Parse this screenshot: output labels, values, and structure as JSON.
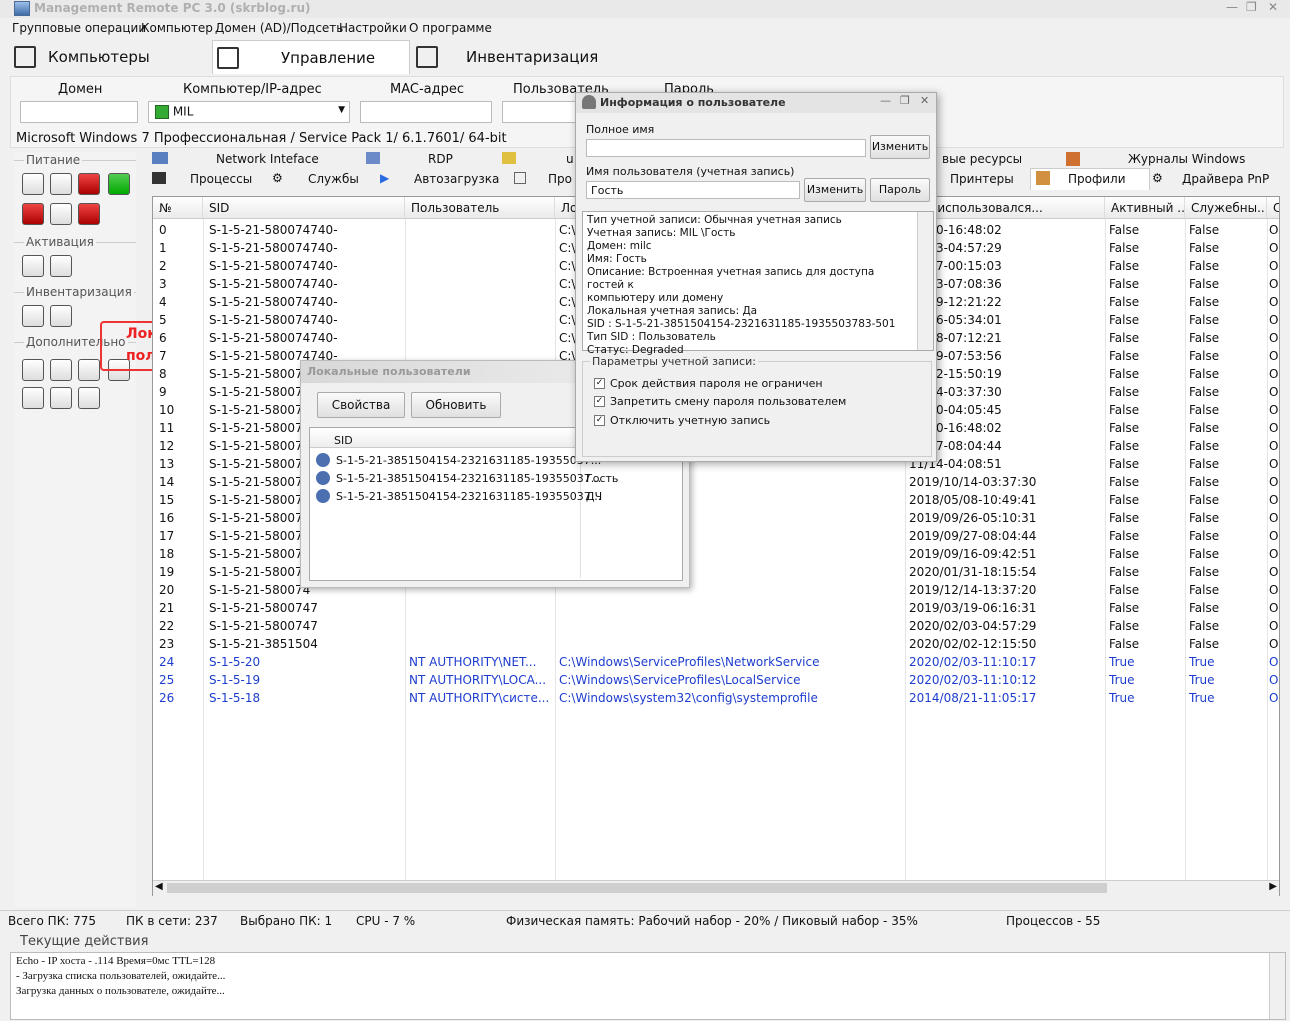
{
  "window": {
    "title": "Management Remote PC 3.0 (skrblog.ru)"
  },
  "menu": [
    "Групповые операции",
    "Компьютер",
    "Домен (AD)/Подсеть",
    "Настройки",
    "О программе"
  ],
  "tabs": {
    "computers": "Компьютеры",
    "control": "Управление",
    "inventory": "Инвентаризация"
  },
  "fields": {
    "domain_label": "Домен",
    "computer_label": "Компьютер/IP-адрес",
    "computer_value": "MIL",
    "mac_label": "MAC-адрес",
    "user_label": "Пользователь",
    "pass_label": "Пароль"
  },
  "os_info": "Microsoft Windows 7 Профессиональная / Service Pack 1/ 6.1.7601/ 64-bit",
  "sidebar": {
    "power": "Питание",
    "activation": "Активация",
    "inventory": "Инвентаризация",
    "extra": "Дополнительно"
  },
  "callout": "Локальные пользователи",
  "subtabs": {
    "network": "Network Inteface",
    "rdp": "RDP",
    "u": "u",
    "shared": "вые ресурсы",
    "journals": "Журналы Windows",
    "processes": "Процессы",
    "services": "Службы",
    "autostart": "Автозагрузка",
    "pro": "Про",
    "printers": "Принтеры",
    "profiles": "Профили",
    "pnp": "Драйвера PnP"
  },
  "grid": {
    "headers": [
      "№",
      "SID",
      "Пользователь",
      "Ло",
      "иль использовался...",
      "Активный ...",
      "Служебны...",
      "Ст"
    ],
    "rows": [
      [
        "0",
        "S-1-5-21-580074740-",
        "",
        "C:\\",
        "01/30-16:48:02",
        "False",
        "False",
        "O"
      ],
      [
        "1",
        "S-1-5-21-580074740-",
        "",
        "C:\\",
        "02/03-04:57:29",
        "False",
        "False",
        "O"
      ],
      [
        "2",
        "S-1-5-21-580074740-",
        "",
        "C:\\",
        "05/17-00:15:03",
        "False",
        "False",
        "O"
      ],
      [
        "3",
        "S-1-5-21-580074740-",
        "",
        "C:\\",
        "01/23-07:08:36",
        "False",
        "False",
        "O"
      ],
      [
        "4",
        "S-1-5-21-580074740-",
        "",
        "C:\\",
        "12/09-12:21:22",
        "False",
        "False",
        "O"
      ],
      [
        "5",
        "S-1-5-21-580074740-",
        "",
        "C:\\",
        "12/06-05:34:01",
        "False",
        "False",
        "O"
      ],
      [
        "6",
        "S-1-5-21-580074740-",
        "",
        "C:\\",
        "11/18-07:12:21",
        "False",
        "False",
        "O"
      ],
      [
        "7",
        "S-1-5-21-580074740-",
        "",
        "C:\\",
        "12/09-07:53:56",
        "False",
        "False",
        "O"
      ],
      [
        "8",
        "S-1-5-21-580074",
        "",
        "",
        "04/22-15:50:19",
        "False",
        "False",
        "O"
      ],
      [
        "9",
        "S-1-5-21-580074",
        "",
        "",
        "10/14-03:37:30",
        "False",
        "False",
        "O"
      ],
      [
        "10",
        "S-1-5-21-580074",
        "",
        "",
        "12/30-04:05:45",
        "False",
        "False",
        "O"
      ],
      [
        "11",
        "S-1-5-21-580074",
        "",
        "",
        "01/30-16:48:02",
        "False",
        "False",
        "O"
      ],
      [
        "12",
        "S-1-5-21-580074",
        "",
        "",
        "09/27-08:04:44",
        "False",
        "False",
        "O"
      ],
      [
        "13",
        "S-1-5-21-580074",
        "",
        "",
        "11/14-04:08:51",
        "False",
        "False",
        "O"
      ],
      [
        "14",
        "S-1-5-21-580074",
        "",
        "",
        "2019/10/14-03:37:30",
        "False",
        "False",
        "O"
      ],
      [
        "15",
        "S-1-5-21-580074",
        "",
        "",
        "2018/05/08-10:49:41",
        "False",
        "False",
        "O"
      ],
      [
        "16",
        "S-1-5-21-580074",
        "",
        "ьга",
        "2019/09/26-05:10:31",
        "False",
        "False",
        "O"
      ],
      [
        "17",
        "S-1-5-21-580074",
        "",
        "лай",
        "2019/09/27-08:04:44",
        "False",
        "False",
        "O"
      ],
      [
        "18",
        "S-1-5-21-580074",
        "",
        "сандр",
        "2019/09/16-09:42:51",
        "False",
        "False",
        "O"
      ],
      [
        "19",
        "S-1-5-21-580074",
        "",
        "",
        "2020/01/31-18:15:54",
        "False",
        "False",
        "O"
      ],
      [
        "20",
        "S-1-5-21-580074",
        "",
        "",
        "2019/12/14-13:37:20",
        "False",
        "False",
        "O"
      ],
      [
        "21",
        "S-1-5-21-5800747",
        "",
        "",
        "2019/03/19-06:16:31",
        "False",
        "False",
        "O"
      ],
      [
        "22",
        "S-1-5-21-5800747",
        "",
        "",
        "2020/02/03-04:57:29",
        "False",
        "False",
        "O"
      ],
      [
        "23",
        "S-1-5-21-3851504",
        "",
        "",
        "2020/02/02-12:15:50",
        "False",
        "False",
        "O"
      ],
      [
        "24",
        "S-1-5-20",
        "NT AUTHORITY\\NET...",
        "C:\\Windows\\ServiceProfiles\\NetworkService",
        "2020/02/03-11:10:17",
        "True",
        "True",
        "O"
      ],
      [
        "25",
        "S-1-5-19",
        "NT AUTHORITY\\LOCA...",
        "C:\\Windows\\ServiceProfiles\\LocalService",
        "2020/02/03-11:10:12",
        "True",
        "True",
        "O"
      ],
      [
        "26",
        "S-1-5-18",
        "NT AUTHORITY\\систе...",
        "C:\\Windows\\system32\\config\\systemprofile",
        "2014/08/21-11:05:17",
        "True",
        "True",
        "O"
      ]
    ]
  },
  "statusbar": {
    "total": "Всего ПК: 775",
    "online": "ПК в сети: 237",
    "selected": "Выбрано ПК: 1",
    "cpu": "CPU - 7 %",
    "memory": "Физическая память: Рабочий набор - 20% / Пиковый набор - 35%",
    "processes": "Процессов - 55"
  },
  "current_actions": {
    "label": "Текущие действия",
    "lines": [
      "Echo - IP хоста -          .114  Время=0мс  TTL=128",
      "          - Загрузка списка пользователей, ожидайте...",
      "Загрузка данных о пользователе, ожидайте..."
    ]
  },
  "local_users_dialog": {
    "title": "Локальные пользователи",
    "properties": "Свойства",
    "refresh": "Обновить",
    "sid_header": "SID",
    "rows": [
      {
        "sid": "S-1-5-21-3851504154-2321631185-19355037...",
        "name": ""
      },
      {
        "sid": "S-1-5-21-3851504154-2321631185-19355037...",
        "name": "Гость"
      },
      {
        "sid": "S-1-5-21-3851504154-2321631185-19355037...",
        "name": "ДЧ"
      }
    ]
  },
  "user_info_dialog": {
    "title": "Информация о пользователе",
    "fullname_label": "Полное имя",
    "change": "Изменить",
    "username_label": "Имя пользователя (учетная запись)",
    "username_value": "Гость",
    "change2": "Изменить",
    "password": "Пароль",
    "info_lines": [
      "Тип учетной записи: Обычная учетная запись",
      "Учетная запись: MIL           \\Гость",
      "Домен: milc",
      "Имя: Гость",
      "Описание: Встроенная учетная запись для доступа гостей к",
      "компьютеру или домену",
      "Локальная учетная запись: Да",
      "SID : S-1-5-21-3851504154-2321631185-1935503783-501",
      "Тип SID : Пользователь",
      "Статус: Degraded"
    ],
    "params_label": "Параметры учетной записи:",
    "check1": "Срок действия пароля не ограничен",
    "check2": "Запретить смену пароля пользователем",
    "check3": "Отключить учетную запись"
  }
}
